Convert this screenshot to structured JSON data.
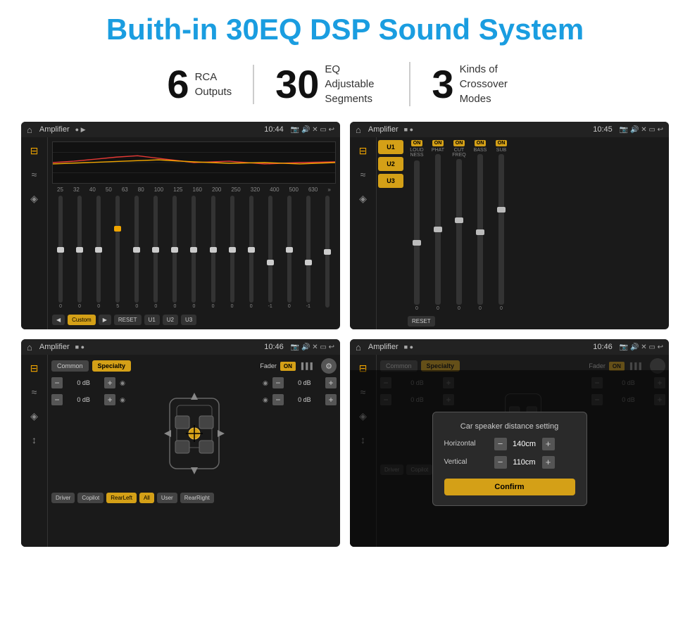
{
  "page": {
    "title": "Buith-in 30EQ DSP Sound System",
    "stats": [
      {
        "number": "6",
        "label": "RCA\nOutputs"
      },
      {
        "number": "30",
        "label": "EQ Adjustable\nSegments"
      },
      {
        "number": "3",
        "label": "Kinds of\nCrossover Modes"
      }
    ],
    "screens": [
      {
        "id": "eq-screen",
        "status_bar": {
          "app": "Amplifier",
          "time": "10:44"
        },
        "type": "eq"
      },
      {
        "id": "u-screen",
        "status_bar": {
          "app": "Amplifier",
          "time": "10:45"
        },
        "type": "u-channels"
      },
      {
        "id": "crossover-screen",
        "status_bar": {
          "app": "Amplifier",
          "time": "10:46"
        },
        "type": "crossover"
      },
      {
        "id": "dialog-screen",
        "status_bar": {
          "app": "Amplifier",
          "time": "10:46"
        },
        "type": "dialog"
      }
    ],
    "eq": {
      "bands": [
        "25",
        "32",
        "40",
        "50",
        "63",
        "80",
        "100",
        "125",
        "160",
        "200",
        "250",
        "320",
        "400",
        "500",
        "630"
      ],
      "values": [
        "0",
        "0",
        "0",
        "5",
        "0",
        "0",
        "0",
        "0",
        "0",
        "0",
        "0",
        "-1",
        "0",
        "-1",
        ""
      ],
      "thumbPositions": [
        50,
        50,
        50,
        30,
        50,
        50,
        50,
        50,
        50,
        50,
        50,
        65,
        50,
        65,
        50
      ],
      "preset": "Custom",
      "buttons": [
        "Custom",
        "RESET",
        "U1",
        "U2",
        "U3"
      ]
    },
    "u_channels": {
      "u_buttons": [
        "U1",
        "U2",
        "U3"
      ],
      "channels": [
        {
          "label": "LOUDNESS",
          "on": true,
          "thumbPos": 60
        },
        {
          "label": "PHAT",
          "on": true,
          "thumbPos": 50
        },
        {
          "label": "CUT FREQ",
          "on": true,
          "thumbPos": 45
        },
        {
          "label": "BASS",
          "on": true,
          "thumbPos": 55
        },
        {
          "label": "SUB",
          "on": true,
          "thumbPos": 40
        }
      ],
      "reset_label": "RESET"
    },
    "crossover": {
      "tabs": [
        "Common",
        "Specialty"
      ],
      "fader_label": "Fader",
      "on_label": "ON",
      "db_left_top": "0 dB",
      "db_left_bottom": "0 dB",
      "db_right_top": "0 dB",
      "db_right_bottom": "0 dB",
      "labels": [
        "Driver",
        "Copilot",
        "RearLeft",
        "All",
        "User",
        "RearRight"
      ]
    },
    "dialog": {
      "title": "Car speaker distance setting",
      "horizontal_label": "Horizontal",
      "horizontal_value": "140cm",
      "vertical_label": "Vertical",
      "vertical_value": "110cm",
      "confirm_label": "Confirm",
      "db_right_top": "0 dB",
      "db_right_bottom": "0 dB"
    }
  }
}
